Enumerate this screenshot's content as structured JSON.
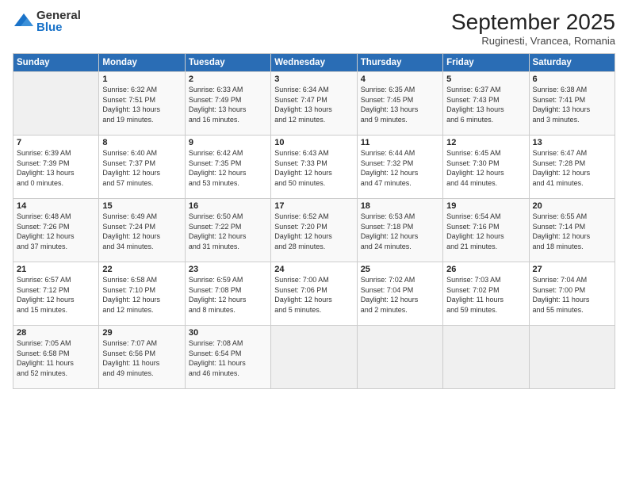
{
  "logo": {
    "general": "General",
    "blue": "Blue"
  },
  "title": "September 2025",
  "location": "Ruginesti, Vrancea, Romania",
  "days_of_week": [
    "Sunday",
    "Monday",
    "Tuesday",
    "Wednesday",
    "Thursday",
    "Friday",
    "Saturday"
  ],
  "weeks": [
    [
      {
        "day": "",
        "info": ""
      },
      {
        "day": "1",
        "info": "Sunrise: 6:32 AM\nSunset: 7:51 PM\nDaylight: 13 hours\nand 19 minutes."
      },
      {
        "day": "2",
        "info": "Sunrise: 6:33 AM\nSunset: 7:49 PM\nDaylight: 13 hours\nand 16 minutes."
      },
      {
        "day": "3",
        "info": "Sunrise: 6:34 AM\nSunset: 7:47 PM\nDaylight: 13 hours\nand 12 minutes."
      },
      {
        "day": "4",
        "info": "Sunrise: 6:35 AM\nSunset: 7:45 PM\nDaylight: 13 hours\nand 9 minutes."
      },
      {
        "day": "5",
        "info": "Sunrise: 6:37 AM\nSunset: 7:43 PM\nDaylight: 13 hours\nand 6 minutes."
      },
      {
        "day": "6",
        "info": "Sunrise: 6:38 AM\nSunset: 7:41 PM\nDaylight: 13 hours\nand 3 minutes."
      }
    ],
    [
      {
        "day": "7",
        "info": "Sunrise: 6:39 AM\nSunset: 7:39 PM\nDaylight: 13 hours\nand 0 minutes."
      },
      {
        "day": "8",
        "info": "Sunrise: 6:40 AM\nSunset: 7:37 PM\nDaylight: 12 hours\nand 57 minutes."
      },
      {
        "day": "9",
        "info": "Sunrise: 6:42 AM\nSunset: 7:35 PM\nDaylight: 12 hours\nand 53 minutes."
      },
      {
        "day": "10",
        "info": "Sunrise: 6:43 AM\nSunset: 7:33 PM\nDaylight: 12 hours\nand 50 minutes."
      },
      {
        "day": "11",
        "info": "Sunrise: 6:44 AM\nSunset: 7:32 PM\nDaylight: 12 hours\nand 47 minutes."
      },
      {
        "day": "12",
        "info": "Sunrise: 6:45 AM\nSunset: 7:30 PM\nDaylight: 12 hours\nand 44 minutes."
      },
      {
        "day": "13",
        "info": "Sunrise: 6:47 AM\nSunset: 7:28 PM\nDaylight: 12 hours\nand 41 minutes."
      }
    ],
    [
      {
        "day": "14",
        "info": "Sunrise: 6:48 AM\nSunset: 7:26 PM\nDaylight: 12 hours\nand 37 minutes."
      },
      {
        "day": "15",
        "info": "Sunrise: 6:49 AM\nSunset: 7:24 PM\nDaylight: 12 hours\nand 34 minutes."
      },
      {
        "day": "16",
        "info": "Sunrise: 6:50 AM\nSunset: 7:22 PM\nDaylight: 12 hours\nand 31 minutes."
      },
      {
        "day": "17",
        "info": "Sunrise: 6:52 AM\nSunset: 7:20 PM\nDaylight: 12 hours\nand 28 minutes."
      },
      {
        "day": "18",
        "info": "Sunrise: 6:53 AM\nSunset: 7:18 PM\nDaylight: 12 hours\nand 24 minutes."
      },
      {
        "day": "19",
        "info": "Sunrise: 6:54 AM\nSunset: 7:16 PM\nDaylight: 12 hours\nand 21 minutes."
      },
      {
        "day": "20",
        "info": "Sunrise: 6:55 AM\nSunset: 7:14 PM\nDaylight: 12 hours\nand 18 minutes."
      }
    ],
    [
      {
        "day": "21",
        "info": "Sunrise: 6:57 AM\nSunset: 7:12 PM\nDaylight: 12 hours\nand 15 minutes."
      },
      {
        "day": "22",
        "info": "Sunrise: 6:58 AM\nSunset: 7:10 PM\nDaylight: 12 hours\nand 12 minutes."
      },
      {
        "day": "23",
        "info": "Sunrise: 6:59 AM\nSunset: 7:08 PM\nDaylight: 12 hours\nand 8 minutes."
      },
      {
        "day": "24",
        "info": "Sunrise: 7:00 AM\nSunset: 7:06 PM\nDaylight: 12 hours\nand 5 minutes."
      },
      {
        "day": "25",
        "info": "Sunrise: 7:02 AM\nSunset: 7:04 PM\nDaylight: 12 hours\nand 2 minutes."
      },
      {
        "day": "26",
        "info": "Sunrise: 7:03 AM\nSunset: 7:02 PM\nDaylight: 11 hours\nand 59 minutes."
      },
      {
        "day": "27",
        "info": "Sunrise: 7:04 AM\nSunset: 7:00 PM\nDaylight: 11 hours\nand 55 minutes."
      }
    ],
    [
      {
        "day": "28",
        "info": "Sunrise: 7:05 AM\nSunset: 6:58 PM\nDaylight: 11 hours\nand 52 minutes."
      },
      {
        "day": "29",
        "info": "Sunrise: 7:07 AM\nSunset: 6:56 PM\nDaylight: 11 hours\nand 49 minutes."
      },
      {
        "day": "30",
        "info": "Sunrise: 7:08 AM\nSunset: 6:54 PM\nDaylight: 11 hours\nand 46 minutes."
      },
      {
        "day": "",
        "info": ""
      },
      {
        "day": "",
        "info": ""
      },
      {
        "day": "",
        "info": ""
      },
      {
        "day": "",
        "info": ""
      }
    ]
  ]
}
